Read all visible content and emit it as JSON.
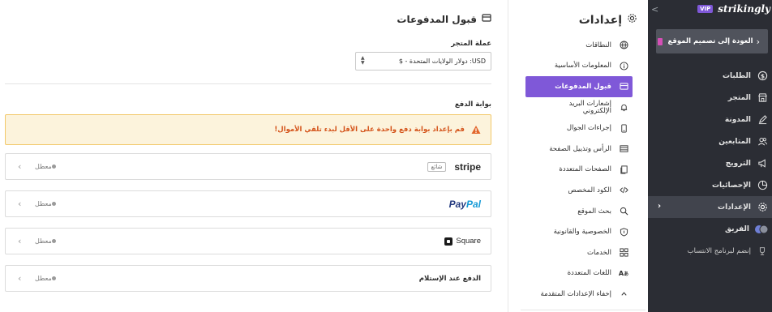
{
  "sidebar": {
    "collapse_glyph": "<",
    "vip": "VIP",
    "logo": "strikingly",
    "back_button": "العودة إلى تصميم الموقع",
    "items": [
      {
        "label": "الطلبات",
        "icon": "dollar-circle-icon"
      },
      {
        "label": "المتجر",
        "icon": "store-icon"
      },
      {
        "label": "المدونة",
        "icon": "pen-icon"
      },
      {
        "label": "المتابعين",
        "icon": "users-icon"
      },
      {
        "label": "الترويج",
        "icon": "megaphone-icon"
      },
      {
        "label": "الإحصائيات",
        "icon": "pie-chart-icon"
      },
      {
        "label": "الإعدادات",
        "icon": "gear-icon",
        "active": true
      },
      {
        "label": "الفريق",
        "icon": "team-avatars-icon"
      },
      {
        "label": "إنضم لبرنامج الانتساب",
        "icon": "trophy-icon"
      }
    ]
  },
  "settings_menu": {
    "title": "إعدادات",
    "items": [
      {
        "label": "النطاقات",
        "icon": "globe-icon"
      },
      {
        "label": "المعلومات الأساسية",
        "icon": "info-icon"
      },
      {
        "label": "قبول المدفوعات",
        "icon": "payment-card-icon",
        "active": true
      },
      {
        "label": "إشعارات البريد الإلكتروني",
        "icon": "bell-icon"
      },
      {
        "label": "إجراءات الجوال",
        "icon": "mobile-icon"
      },
      {
        "label": "الرأس وتذييل الصفحة",
        "icon": "header-footer-icon"
      },
      {
        "label": "الصفحات المتعددة",
        "icon": "pages-icon"
      },
      {
        "label": "الكود المخصص",
        "icon": "code-icon"
      },
      {
        "label": "بحث الموقع",
        "icon": "search-icon"
      },
      {
        "label": "الخصوصية والقانونية",
        "icon": "shield-icon"
      },
      {
        "label": "الخدمات",
        "icon": "grid-icon"
      },
      {
        "label": "اللغات المتعددة",
        "icon": "language-icon"
      },
      {
        "label": "إخفاء الإعدادات المتقدمة",
        "icon": "chevron-up-icon"
      }
    ]
  },
  "main": {
    "title": "قبول المدفوعات",
    "currency_label": "عملة المتجر",
    "currency_value": "USD: دولار الولايات المتحدة - $",
    "gateway_label": "بوابة الدفع",
    "warning": "قم بإعداد بوابة دفع واحدة على الأقل لبدء تلقي الأموال!",
    "gateways": [
      {
        "name": "stripe",
        "tag": "شائع",
        "status": "معطل"
      },
      {
        "name_pay": "Pay",
        "name_pal": "Pal",
        "status": "معطل"
      },
      {
        "name": "Square",
        "status": "معطل"
      },
      {
        "name": "الدفع عند الإستلام",
        "status": "معطل"
      }
    ]
  },
  "colors": {
    "accent": "#7f58d8",
    "sidebar_bg": "#2b2d34",
    "warning_bg": "#fcf3dc",
    "warning_text": "#d4531a"
  }
}
